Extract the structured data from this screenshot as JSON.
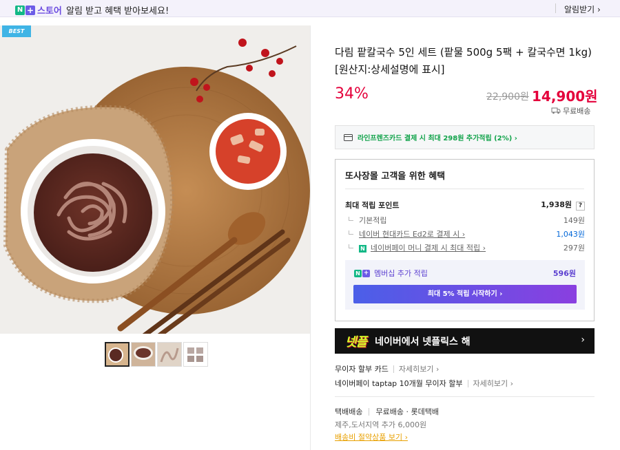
{
  "banner": {
    "logo_n": "N",
    "logo_plus": "+",
    "logo_text": "스토어",
    "message": "알림 받고 혜택 받아보세요!",
    "alarm_button": "알림받기 ›"
  },
  "gallery": {
    "badge": "BEST",
    "thumbnails": [
      "팥칼국수 그릇",
      "팥칼국수 클로즈업",
      "칼국수 면",
      "상품 패키지"
    ],
    "selected_index": 0
  },
  "product": {
    "title": "다림 팥칼국수 5인 세트 (팥물 500g 5팩 + 칼국수면 1kg) [원산지:상세설명에 표시]",
    "discount": "34%",
    "original_price": "22,900원",
    "sale_price": "14,900원",
    "shipping": "무료배송"
  },
  "card_promo": {
    "text": "라인프렌즈카드 결제 시 최대 298원 추가적립 (2%) ›"
  },
  "benefits": {
    "title": "또사장몰 고객을 위한 혜택",
    "max_points_label": "최대 적립 포인트",
    "max_points_value": "1,938원",
    "help": "?",
    "rows": [
      {
        "label": "기본적립",
        "value": "149원"
      },
      {
        "label": "네이버 현대카드 Ed2로 결제 시 ›",
        "value": "1,043원"
      },
      {
        "label": "네이버페이 머니 결제 시 최대 적립 ›",
        "value": "297원"
      }
    ],
    "membership_label": "멤버십 추가 적립",
    "membership_value": "596원",
    "membership_button": "최대 5% 적립 시작하기 ›"
  },
  "netflix_banner": {
    "logo": "넷플",
    "text": "네이버에서 넷플릭스 해",
    "chevron": "›"
  },
  "installments": [
    {
      "label": "무이자 할부 카드",
      "more": "자세히보기 ›"
    },
    {
      "label": "네이버페이 taptap 10개월 무이자 할부",
      "more": "자세히보기 ›"
    }
  ],
  "delivery": {
    "type": "택배배송",
    "fee": "무료배송 · 롯데택배",
    "jeju": "제주,도서지역 추가 6,000원",
    "save_link": "배송비 절약상품 보기 ›"
  },
  "colors": {
    "accent_red": "#e4003b",
    "naver_green": "#12b886",
    "store_purple": "#6c4ce0",
    "promo_green": "#11a34a",
    "membership_purple": "#5b3fd0"
  }
}
